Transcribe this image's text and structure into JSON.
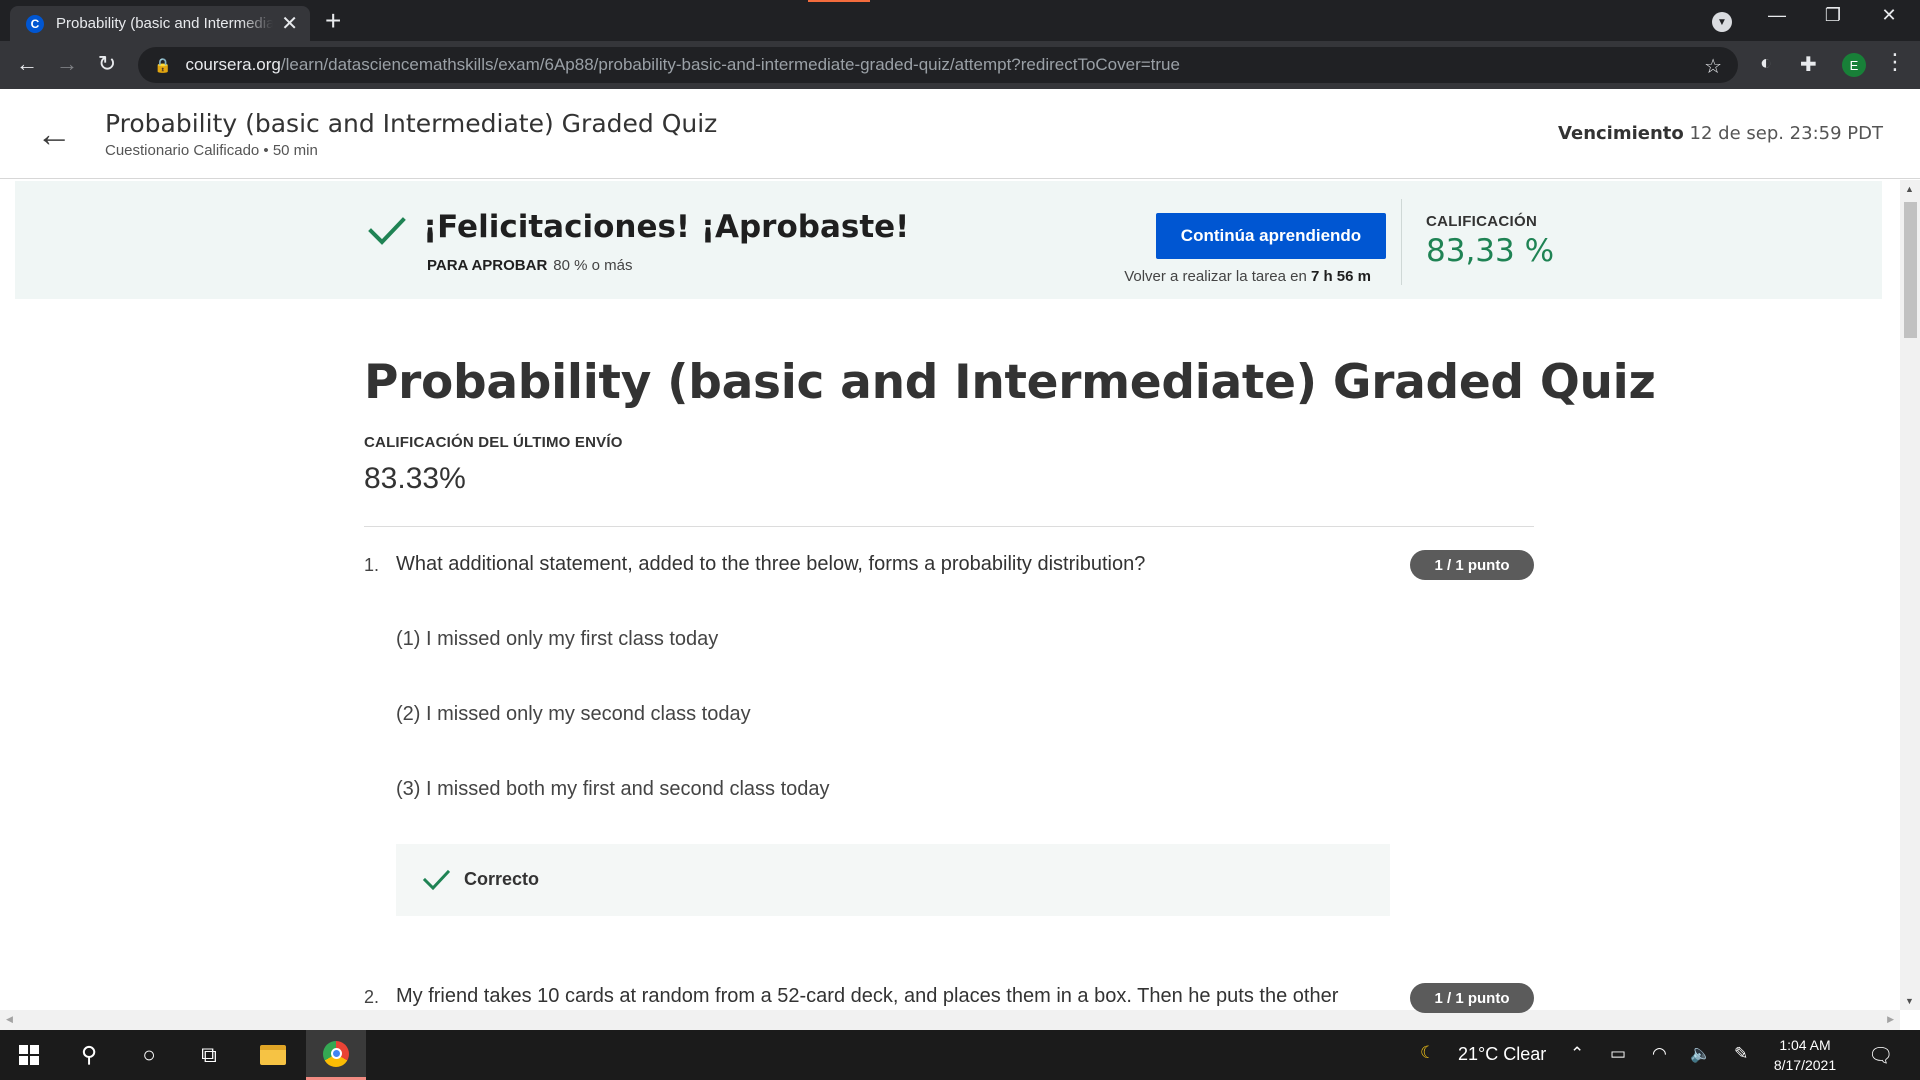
{
  "browser": {
    "tab_title": "Probability (basic and Intermediate) Graded Quiz",
    "url_host": "coursera.org",
    "url_path": "/learn/datasciencemathskills/exam/6Ap88/probability-basic-and-intermediate-graded-quiz/attempt?redirectToCover=true",
    "profile_initial": "E",
    "favicon_letter": "C"
  },
  "header": {
    "title": "Probability (basic and Intermediate) Graded Quiz",
    "subtitle": "Cuestionario Calificado • 50 min",
    "due_label": "Vencimiento",
    "due_value": "12 de sep. 23:59 PDT"
  },
  "banner": {
    "title": "¡Felicitaciones! ¡Aprobaste!",
    "pass_label": "PARA APROBAR",
    "pass_value": "80 % o más",
    "continue_label": "Continúa aprendiendo",
    "retry_text": "Volver a realizar la tarea en",
    "retry_time": "7 h 56 m",
    "grade_label": "CALIFICACIÓN",
    "grade_value": "83,33 %"
  },
  "main": {
    "title": "Probability (basic and Intermediate) Graded Quiz",
    "last_grade_label": "CALIFICACIÓN DEL ÚLTIMO ENVÍO",
    "last_grade_value": "83.33%",
    "questions": [
      {
        "number": "1.",
        "text": "What additional statement, added to the three below, forms a probability distribution?",
        "points": "1 / 1 punto",
        "options": [
          "(1) I missed only my first class today",
          "(2) I missed only my second class today",
          "(3) I missed both my first and second class today"
        ],
        "feedback": "Correcto"
      },
      {
        "number": "2.",
        "text": "My friend takes 10 cards at random from a 52-card deck, and places them in a box. Then he puts the other",
        "points": "1 / 1 punto"
      }
    ]
  },
  "taskbar": {
    "weather": "21°C  Clear",
    "time": "1:04 AM",
    "date": "8/17/2021"
  },
  "colors": {
    "brand_blue": "#0056d2",
    "success_green": "#1f8354",
    "banner_bg": "#f0f6f5"
  }
}
